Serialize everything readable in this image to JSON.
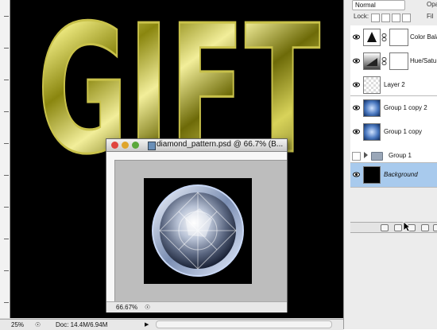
{
  "document": {
    "artwork_text": "GIFT",
    "status": {
      "zoom": "25%",
      "doc_info": "Doc: 14.4M/6.94M"
    }
  },
  "layers_panel": {
    "blend_mode": "Normal",
    "opacity_label": "Opaci",
    "lock_label": "Lock:",
    "fill_label": "Fil",
    "layers": [
      {
        "name": "Color Bala",
        "visible": true,
        "type": "adjustment-color-balance",
        "selected": false
      },
      {
        "name": "Hue/Satu",
        "visible": true,
        "type": "adjustment-hue-saturation",
        "selected": false
      },
      {
        "name": "Layer 2",
        "visible": true,
        "type": "empty",
        "selected": false
      },
      {
        "name": "Group 1 copy 2",
        "visible": true,
        "type": "diamond",
        "selected": false
      },
      {
        "name": "Group 1 copy",
        "visible": true,
        "type": "diamond",
        "selected": false
      },
      {
        "name": "Group 1",
        "visible": false,
        "type": "group",
        "selected": false
      },
      {
        "name": "Background",
        "visible": true,
        "type": "black",
        "selected": true
      }
    ]
  },
  "diamond_window": {
    "title": "diamond_pattern.psd @ 66.7% (B...",
    "zoom": "66.67%"
  }
}
